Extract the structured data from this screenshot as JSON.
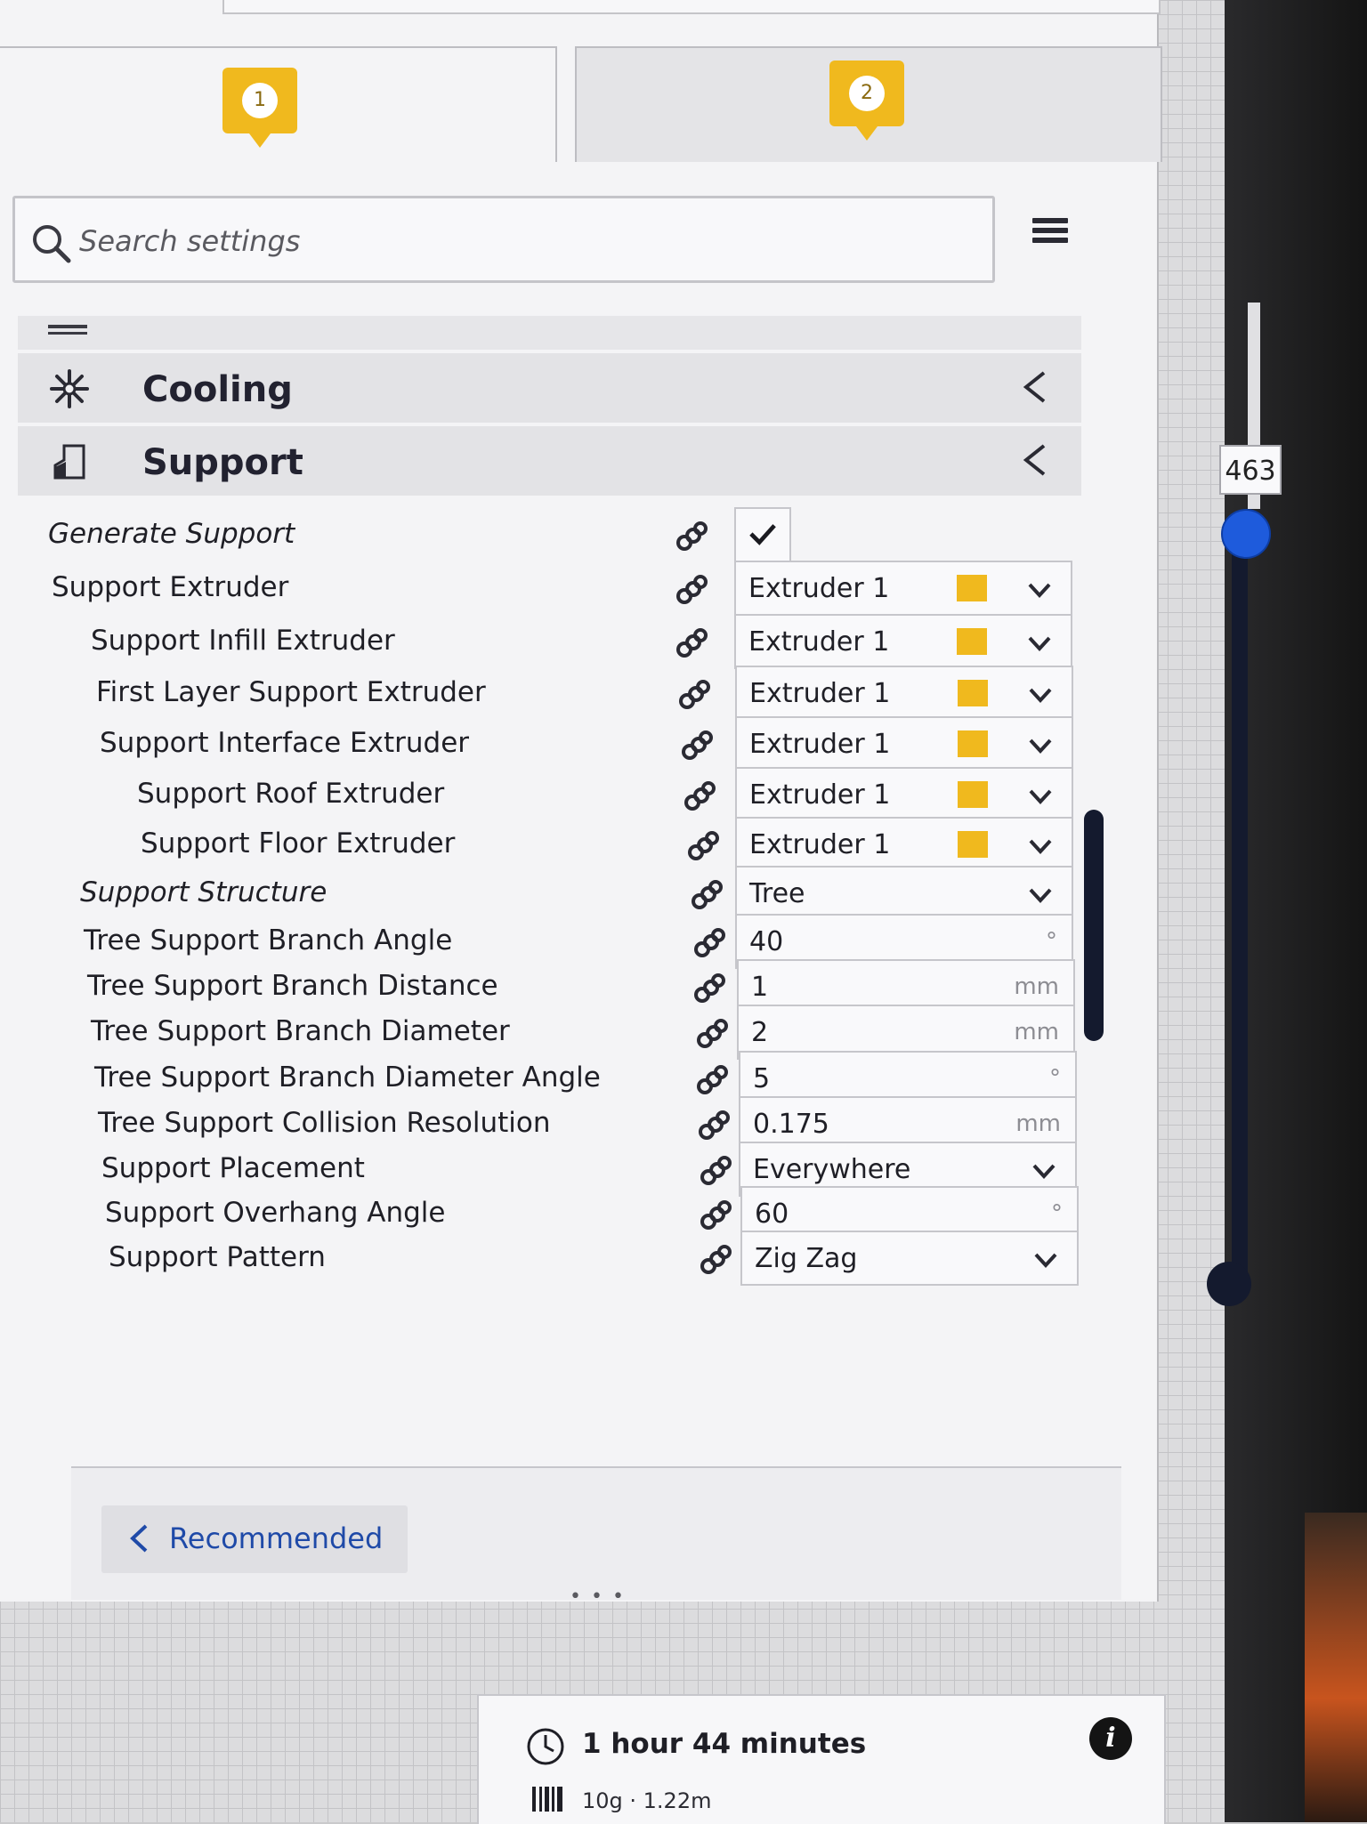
{
  "tabs": [
    {
      "badge": "1",
      "active": true
    },
    {
      "badge": "2",
      "active": false
    }
  ],
  "search": {
    "placeholder": "Search settings"
  },
  "categories": [
    {
      "label": "Cooling",
      "icon": "fan-icon"
    },
    {
      "label": "Support",
      "icon": "support-icon"
    }
  ],
  "settings": [
    {
      "label": "Generate Support",
      "type": "checkbox",
      "checked": true,
      "italic": true
    },
    {
      "label": "Support Extruder",
      "type": "extruder",
      "value": "Extruder 1"
    },
    {
      "label": "Support Infill Extruder",
      "type": "extruder",
      "value": "Extruder 1"
    },
    {
      "label": "First Layer Support Extruder",
      "type": "extruder",
      "value": "Extruder 1"
    },
    {
      "label": "Support Interface Extruder",
      "type": "extruder",
      "value": "Extruder 1"
    },
    {
      "label": "Support Roof Extruder",
      "type": "extruder",
      "value": "Extruder 1"
    },
    {
      "label": "Support Floor Extruder",
      "type": "extruder",
      "value": "Extruder 1"
    },
    {
      "label": "Support Structure",
      "type": "dropdown",
      "value": "Tree",
      "italic": true
    },
    {
      "label": "Tree Support Branch Angle",
      "type": "number",
      "value": "40",
      "unit": "°"
    },
    {
      "label": "Tree Support Branch Distance",
      "type": "number",
      "value": "1",
      "unit": "mm"
    },
    {
      "label": "Tree Support Branch Diameter",
      "type": "number",
      "value": "2",
      "unit": "mm"
    },
    {
      "label": "Tree Support Branch Diameter Angle",
      "type": "number",
      "value": "5",
      "unit": "°"
    },
    {
      "label": "Tree Support Collision Resolution",
      "type": "number",
      "value": "0.175",
      "unit": "mm"
    },
    {
      "label": "Support Placement",
      "type": "dropdown",
      "value": "Everywhere"
    },
    {
      "label": "Support Overhang Angle",
      "type": "number",
      "value": "60",
      "unit": "°"
    },
    {
      "label": "Support Pattern",
      "type": "dropdown",
      "value": "Zig Zag"
    }
  ],
  "footer": {
    "recommended_label": "Recommended"
  },
  "layer_slider": {
    "value": "463"
  },
  "print_info": {
    "time": "1 hour 44 minutes",
    "material": "10g · 1.22m"
  },
  "colors": {
    "accent": "#f0b91e",
    "slider_handle": "#1e5bdc",
    "link_blue": "#1f4aa8"
  }
}
